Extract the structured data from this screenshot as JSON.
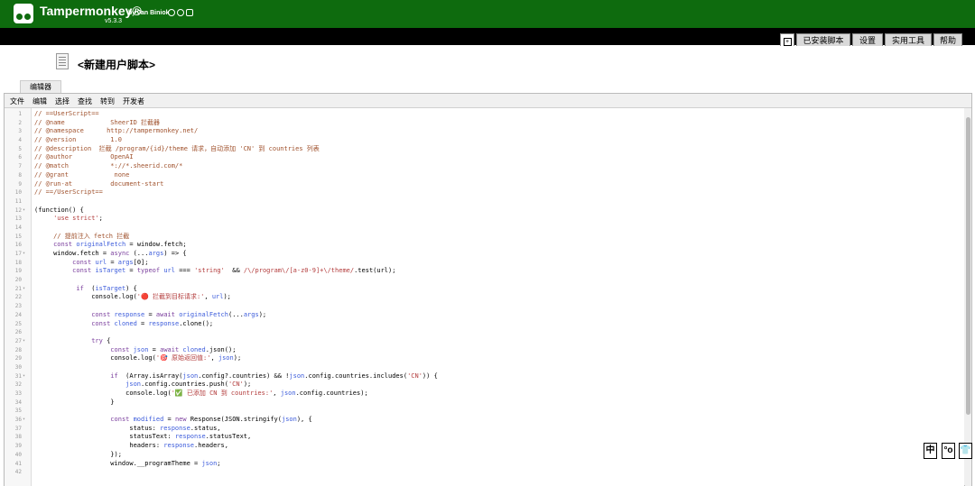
{
  "brand": {
    "name": "Tampermonkey®",
    "by": "by Jan Biniok",
    "version": "v5.3.3"
  },
  "tabs": [
    "已安装脚本",
    "设置",
    "实用工具",
    "帮助"
  ],
  "new_tab_icon": "plus-square-icon",
  "page_title": "<新建用户脚本>",
  "subtab": "编辑器",
  "menu": [
    "文件",
    "编辑",
    "选择",
    "查找",
    "转到",
    "开发者"
  ],
  "code_lines": [
    {
      "n": "1",
      "f": "",
      "s": [
        [
          "c",
          "// ==UserScript=="
        ]
      ]
    },
    {
      "n": "2",
      "f": "",
      "s": [
        [
          "c",
          "// @name            SheerID 拦截器"
        ]
      ]
    },
    {
      "n": "3",
      "f": "",
      "s": [
        [
          "c",
          "// @namespace      http://tampermonkey.net/"
        ]
      ]
    },
    {
      "n": "4",
      "f": "",
      "s": [
        [
          "c",
          "// @version         1.0"
        ]
      ]
    },
    {
      "n": "5",
      "f": "",
      "s": [
        [
          "c",
          "// @description  拦截 /program/{id}/theme 请求，自动添加 'CN' 到 countries 列表"
        ]
      ]
    },
    {
      "n": "6",
      "f": "",
      "s": [
        [
          "c",
          "// @author          OpenAI"
        ]
      ]
    },
    {
      "n": "7",
      "f": "",
      "s": [
        [
          "c",
          "// @match           *://*.sheerid.com/*"
        ]
      ]
    },
    {
      "n": "8",
      "f": "",
      "s": [
        [
          "c",
          "// @grant            none"
        ]
      ]
    },
    {
      "n": "9",
      "f": "",
      "s": [
        [
          "c",
          "// @run-at          document-start"
        ]
      ]
    },
    {
      "n": "10",
      "f": "",
      "s": [
        [
          "c",
          "// ==/UserScript=="
        ]
      ]
    },
    {
      "n": "11",
      "f": "",
      "s": []
    },
    {
      "n": "12",
      "f": "▾",
      "s": [
        [
          "p",
          "(function() {"
        ]
      ]
    },
    {
      "n": "13",
      "f": "",
      "s": [
        [
          "p",
          "     "
        ],
        [
          "s",
          "'use strict'"
        ],
        [
          "p",
          ";"
        ]
      ]
    },
    {
      "n": "14",
      "f": "",
      "s": []
    },
    {
      "n": "15",
      "f": "",
      "s": [
        [
          "c",
          "     // 提前注入 fetch 拦截"
        ]
      ]
    },
    {
      "n": "16",
      "f": "",
      "s": [
        [
          "p",
          "     "
        ],
        [
          "k",
          "const"
        ],
        [
          "p",
          " "
        ],
        [
          "v",
          "originalFetch"
        ],
        [
          "p",
          " = window.fetch;"
        ]
      ]
    },
    {
      "n": "17",
      "f": "▾",
      "s": [
        [
          "p",
          "     window.fetch = "
        ],
        [
          "k",
          "async"
        ],
        [
          "p",
          " (..."
        ],
        [
          "v",
          "args"
        ],
        [
          "p",
          ") => {"
        ]
      ]
    },
    {
      "n": "18",
      "f": "",
      "s": [
        [
          "p",
          "          "
        ],
        [
          "k",
          "const"
        ],
        [
          "p",
          " "
        ],
        [
          "v",
          "url"
        ],
        [
          "p",
          " = "
        ],
        [
          "v",
          "args"
        ],
        [
          "p",
          "[0];"
        ]
      ]
    },
    {
      "n": "19",
      "f": "",
      "s": [
        [
          "p",
          "          "
        ],
        [
          "k",
          "const"
        ],
        [
          "p",
          " "
        ],
        [
          "v",
          "isTarget"
        ],
        [
          "p",
          " = "
        ],
        [
          "k",
          "typeof"
        ],
        [
          "p",
          " "
        ],
        [
          "v",
          "url"
        ],
        [
          "p",
          " === "
        ],
        [
          "s",
          "'string'"
        ],
        [
          "p",
          "  && "
        ],
        [
          "s",
          "/\\/program\\/[a-z0-9]+\\/theme/"
        ],
        [
          "p",
          ".test(url);"
        ]
      ]
    },
    {
      "n": "20",
      "f": "",
      "s": []
    },
    {
      "n": "21",
      "f": "▾",
      "s": [
        [
          "p",
          "           "
        ],
        [
          "k",
          "if"
        ],
        [
          "p",
          "  ("
        ],
        [
          "v",
          "isTarget"
        ],
        [
          "p",
          ") {"
        ]
      ]
    },
    {
      "n": "22",
      "f": "",
      "s": [
        [
          "p",
          "               console.log("
        ],
        [
          "s",
          "'🔴 拦截到目标请求:'"
        ],
        [
          "p",
          ", "
        ],
        [
          "v",
          "url"
        ],
        [
          "p",
          ");"
        ]
      ]
    },
    {
      "n": "23",
      "f": "",
      "s": []
    },
    {
      "n": "24",
      "f": "",
      "s": [
        [
          "p",
          "               "
        ],
        [
          "k",
          "const"
        ],
        [
          "p",
          " "
        ],
        [
          "v",
          "response"
        ],
        [
          "p",
          " = "
        ],
        [
          "k",
          "await"
        ],
        [
          "p",
          " "
        ],
        [
          "v",
          "originalFetch"
        ],
        [
          "p",
          "(..."
        ],
        [
          "v",
          "args"
        ],
        [
          "p",
          ");"
        ]
      ]
    },
    {
      "n": "25",
      "f": "",
      "s": [
        [
          "p",
          "               "
        ],
        [
          "k",
          "const"
        ],
        [
          "p",
          " "
        ],
        [
          "v",
          "cloned"
        ],
        [
          "p",
          " = "
        ],
        [
          "v",
          "response"
        ],
        [
          "p",
          ".clone();"
        ]
      ]
    },
    {
      "n": "26",
      "f": "",
      "s": []
    },
    {
      "n": "27",
      "f": "▾",
      "s": [
        [
          "p",
          "               "
        ],
        [
          "k",
          "try"
        ],
        [
          "p",
          " {"
        ]
      ]
    },
    {
      "n": "28",
      "f": "",
      "s": [
        [
          "p",
          "                    "
        ],
        [
          "k",
          "const"
        ],
        [
          "p",
          " "
        ],
        [
          "v",
          "json"
        ],
        [
          "p",
          " = "
        ],
        [
          "k",
          "await"
        ],
        [
          "p",
          " "
        ],
        [
          "v",
          "cloned"
        ],
        [
          "p",
          ".json();"
        ]
      ]
    },
    {
      "n": "29",
      "f": "",
      "s": [
        [
          "p",
          "                    console.log("
        ],
        [
          "s",
          "'🎯 原始返回值:'"
        ],
        [
          "p",
          ", "
        ],
        [
          "v",
          "json"
        ],
        [
          "p",
          ");"
        ]
      ]
    },
    {
      "n": "30",
      "f": "",
      "s": []
    },
    {
      "n": "31",
      "f": "▾",
      "s": [
        [
          "p",
          "                    "
        ],
        [
          "k",
          "if"
        ],
        [
          "p",
          "  (Array.isArray("
        ],
        [
          "v",
          "json"
        ],
        [
          "p",
          ".config?.countries) && !"
        ],
        [
          "v",
          "json"
        ],
        [
          "p",
          ".config.countries.includes("
        ],
        [
          "s",
          "'CN'"
        ],
        [
          "p",
          ")) {"
        ]
      ]
    },
    {
      "n": "32",
      "f": "",
      "s": [
        [
          "p",
          "                        "
        ],
        [
          "v",
          "json"
        ],
        [
          "p",
          ".config.countries.push("
        ],
        [
          "s",
          "'CN'"
        ],
        [
          "p",
          ");"
        ]
      ]
    },
    {
      "n": "33",
      "f": "",
      "s": [
        [
          "p",
          "                        console.log("
        ],
        [
          "s",
          "'✅ 已添加 CN 到 countries:'"
        ],
        [
          "p",
          ", "
        ],
        [
          "v",
          "json"
        ],
        [
          "p",
          ".config.countries);"
        ]
      ]
    },
    {
      "n": "34",
      "f": "",
      "s": [
        [
          "p",
          "                    }"
        ]
      ]
    },
    {
      "n": "35",
      "f": "",
      "s": []
    },
    {
      "n": "36",
      "f": "▾",
      "s": [
        [
          "p",
          "                    "
        ],
        [
          "k",
          "const"
        ],
        [
          "p",
          " "
        ],
        [
          "v",
          "modified"
        ],
        [
          "p",
          " = "
        ],
        [
          "k",
          "new"
        ],
        [
          "p",
          " Response(JSON.stringify("
        ],
        [
          "v",
          "json"
        ],
        [
          "p",
          "), {"
        ]
      ]
    },
    {
      "n": "37",
      "f": "",
      "s": [
        [
          "p",
          "                         status: "
        ],
        [
          "v",
          "response"
        ],
        [
          "p",
          ".status,"
        ]
      ]
    },
    {
      "n": "38",
      "f": "",
      "s": [
        [
          "p",
          "                         statusText: "
        ],
        [
          "v",
          "response"
        ],
        [
          "p",
          ".statusText,"
        ]
      ]
    },
    {
      "n": "39",
      "f": "",
      "s": [
        [
          "p",
          "                         headers: "
        ],
        [
          "v",
          "response"
        ],
        [
          "p",
          ".headers,"
        ]
      ]
    },
    {
      "n": "40",
      "f": "",
      "s": [
        [
          "p",
          "                    });"
        ]
      ]
    },
    {
      "n": "41",
      "f": "",
      "s": [
        [
          "p",
          "                    window.__programTheme = "
        ],
        [
          "v",
          "json"
        ],
        [
          "p",
          ";"
        ]
      ]
    },
    {
      "n": "42",
      "f": "",
      "s": []
    }
  ],
  "float_buttons": [
    "中",
    "°o",
    "👕"
  ],
  "colors": {
    "header_green": "#0e6b0e",
    "comment": "#a0522d",
    "keyword": "#7a3e9d",
    "variable": "#3b5bdb",
    "string": "#b33c3c"
  }
}
